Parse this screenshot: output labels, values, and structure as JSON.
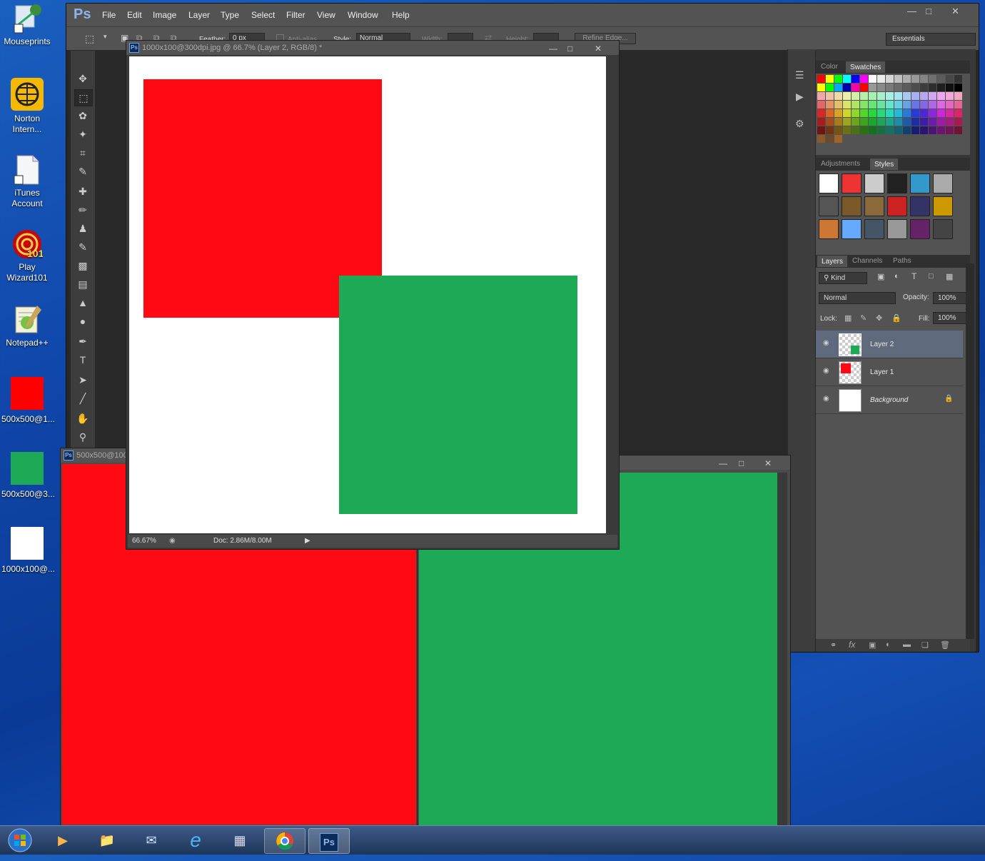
{
  "desktop": {
    "icons": [
      {
        "label": "Mouseprints"
      },
      {
        "label": "Norton Intern..."
      },
      {
        "label": "iTunes Account"
      },
      {
        "label": "Play Wizard101"
      },
      {
        "label": "Notepad++"
      },
      {
        "label": "500x500@1...",
        "color": "#ff0000"
      },
      {
        "label": "500x500@3...",
        "color": "#1ea957"
      },
      {
        "label": "1000x100@...",
        "color": "#ffffff"
      }
    ]
  },
  "app": {
    "logo": "Ps",
    "menu": [
      "File",
      "Edit",
      "Image",
      "Layer",
      "Type",
      "Select",
      "Filter",
      "View",
      "Window",
      "Help"
    ],
    "options": {
      "feather_label": "Feather:",
      "feather_value": "0 px",
      "antialias_label": "Anti-alias",
      "style_label": "Style:",
      "style_value": "Normal",
      "width_label": "Width:",
      "height_label": "Height:",
      "refine_label": "Refine Edge...",
      "workspace": "Essentials"
    }
  },
  "panels": {
    "color_tabs": [
      "Color",
      "Swatches"
    ],
    "style_tabs": [
      "Adjustments",
      "Styles"
    ],
    "layer_tabs": [
      "Layers",
      "Channels",
      "Paths"
    ],
    "kind_label": "Kind",
    "blend_mode": "Normal",
    "opacity_label": "Opacity:",
    "opacity_value": "100%",
    "lock_label": "Lock:",
    "fill_label": "Fill:",
    "fill_value": "100%",
    "layers": [
      {
        "name": "Layer 2",
        "selected": true
      },
      {
        "name": "Layer 1",
        "selected": false
      },
      {
        "name": "Background",
        "selected": false
      }
    ]
  },
  "documents": {
    "front": {
      "title": "1000x100@300dpi.jpg @ 66.7% (Layer 2, RGB/8) *",
      "zoom": "66.67%",
      "doc_info": "Doc: 2.86M/8.00M",
      "red": "#ff0a14",
      "green": "#1ea957"
    },
    "back_left": {
      "title": "500x500@100",
      "color": "#ff0a14"
    },
    "back_right": {
      "color": "#1ea957"
    }
  },
  "taskbar": {
    "items": [
      "start-orb",
      "media-player",
      "file-explorer",
      "thunderbird",
      "internet-explorer",
      "calculator",
      "chrome",
      "photoshop"
    ]
  }
}
